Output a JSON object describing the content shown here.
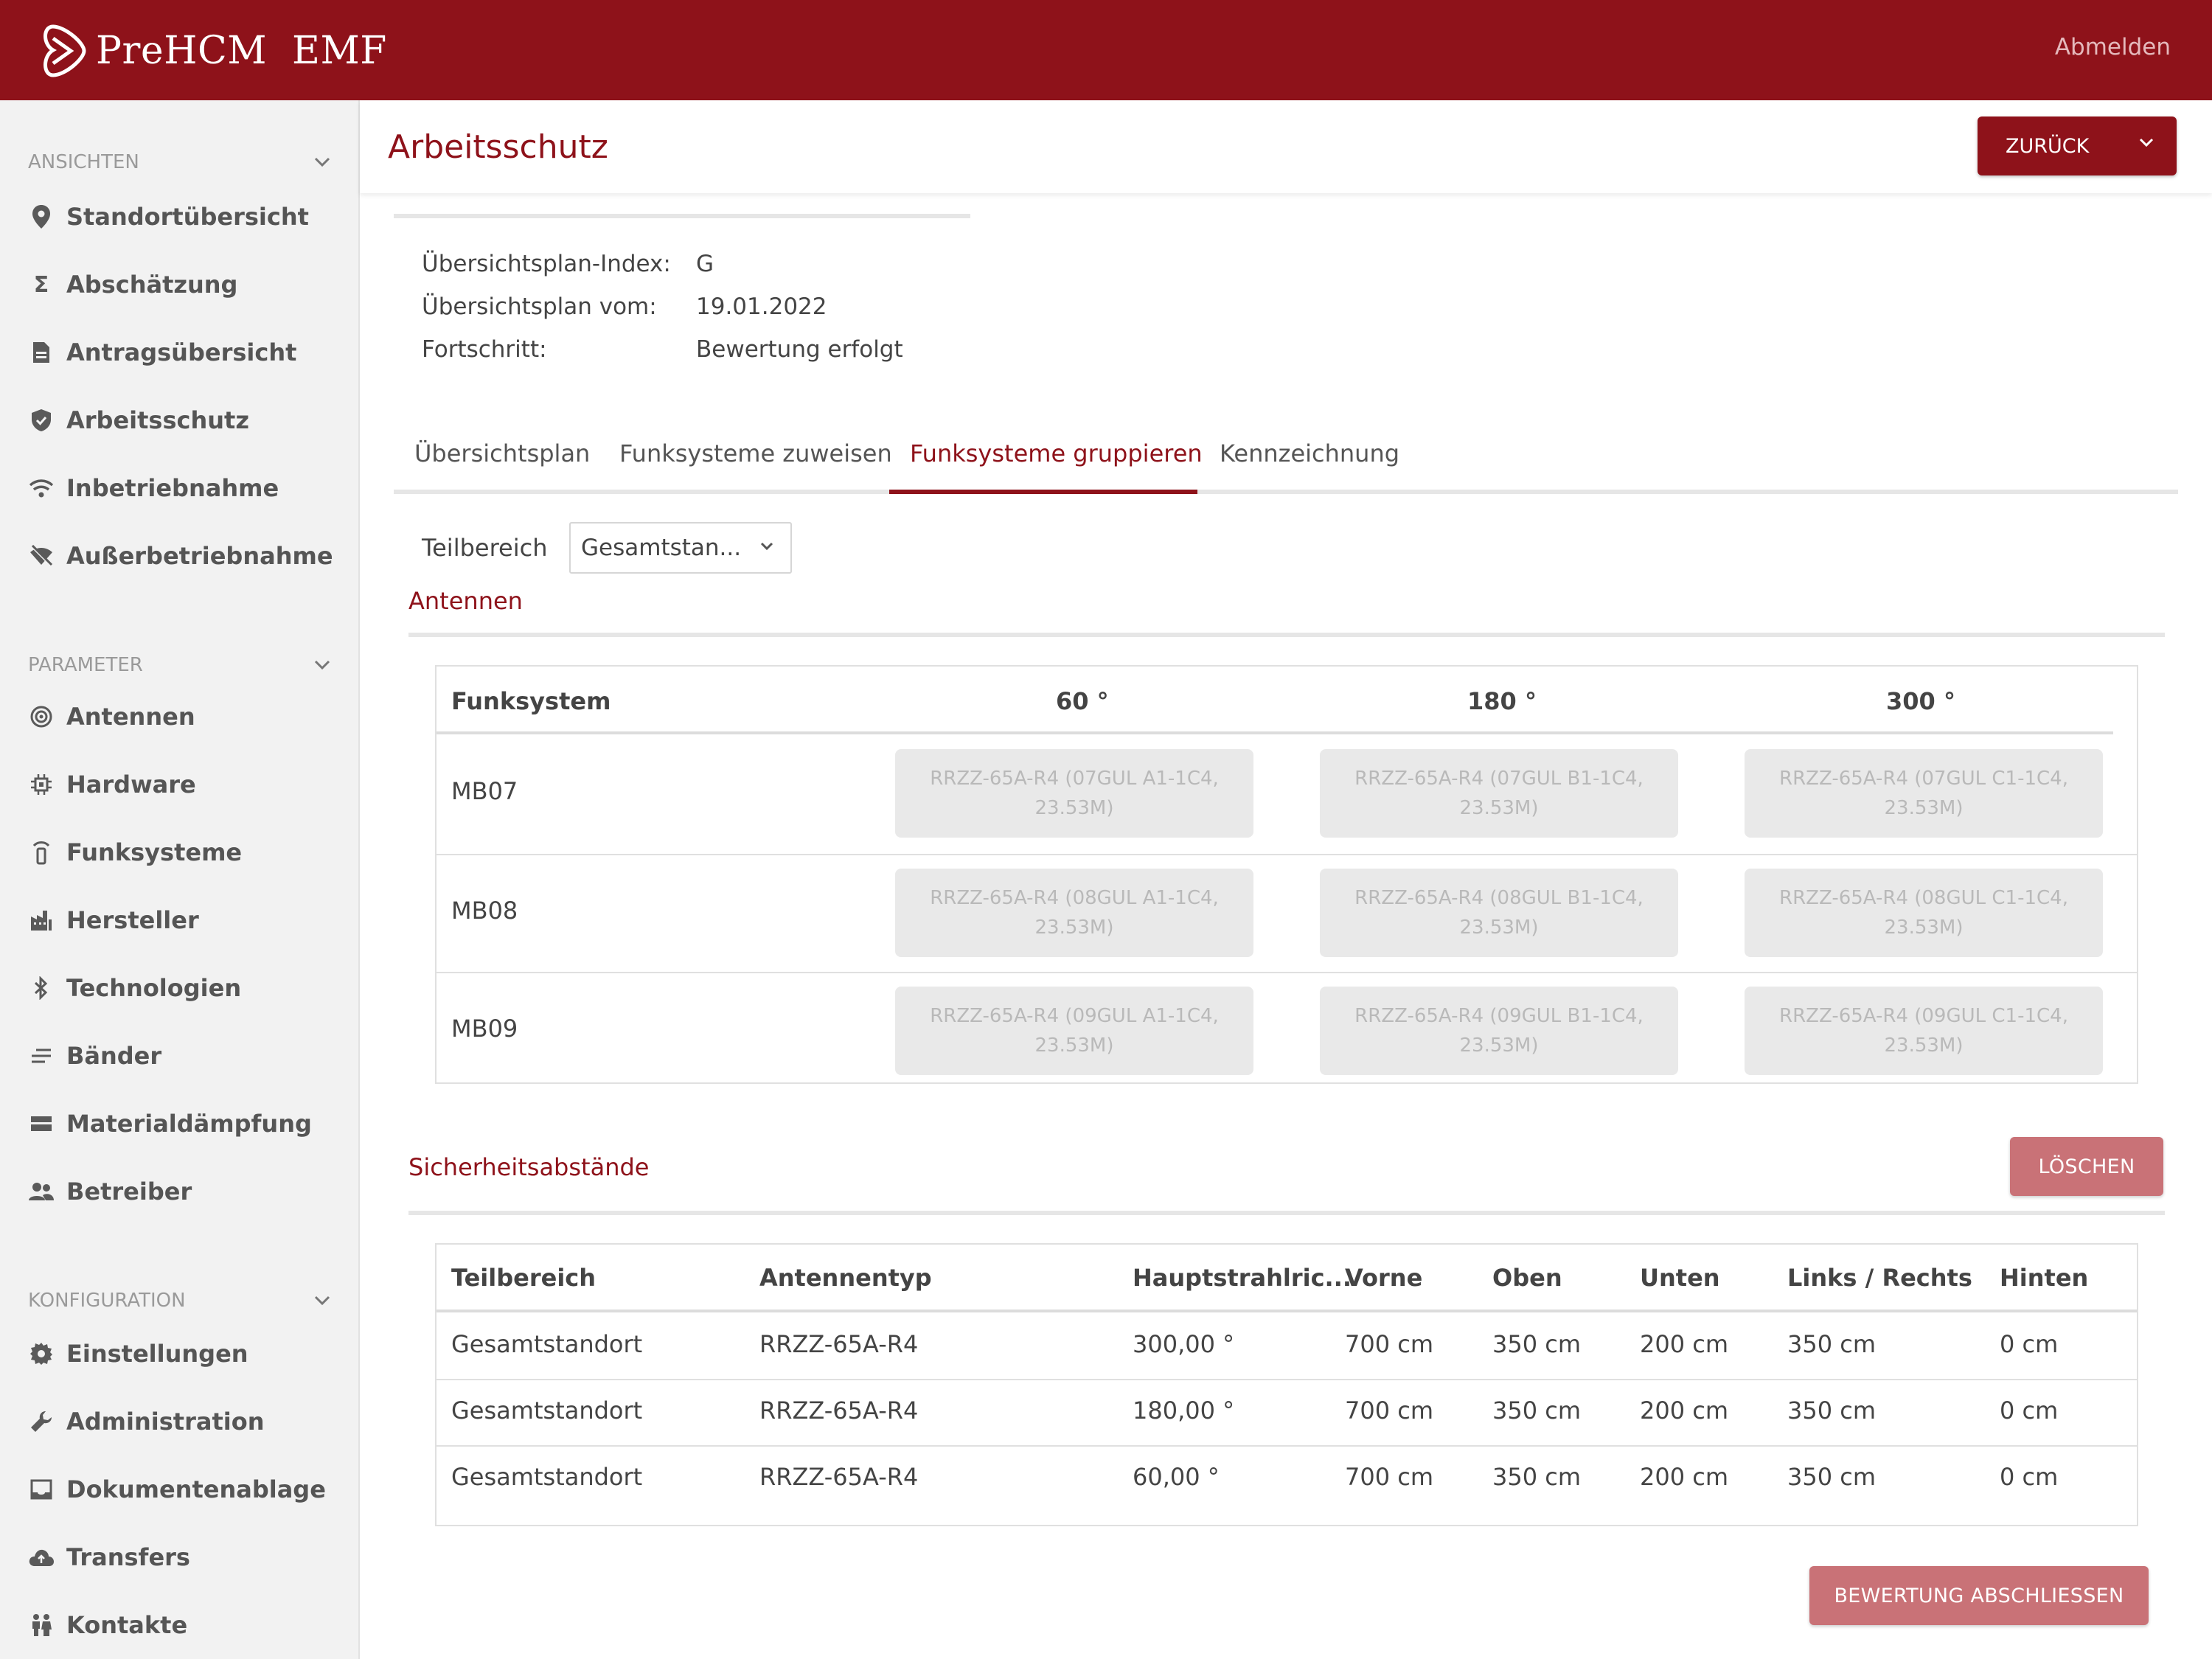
{
  "app": {
    "brand": "PreHCM  EMF",
    "logout_label": "Abmelden",
    "accent_color": "#8e121a"
  },
  "sidebar": {
    "sections": [
      {
        "title": "ANSICHTEN",
        "items": [
          {
            "label": "Standortübersicht",
            "icon": "location-pin-icon"
          },
          {
            "label": "Abschätzung",
            "icon": "sigma-icon"
          },
          {
            "label": "Antragsübersicht",
            "icon": "document-icon"
          },
          {
            "label": "Arbeitsschutz",
            "icon": "shield-icon"
          },
          {
            "label": "Inbetriebnahme",
            "icon": "wifi-icon"
          },
          {
            "label": "Außerbetriebnahme",
            "icon": "wifi-off-icon"
          }
        ]
      },
      {
        "title": "PARAMETER",
        "items": [
          {
            "label": "Antennen",
            "icon": "antenna-icon"
          },
          {
            "label": "Hardware",
            "icon": "chip-icon"
          },
          {
            "label": "Funksysteme",
            "icon": "radio-tower-icon"
          },
          {
            "label": "Hersteller",
            "icon": "factory-icon"
          },
          {
            "label": "Technologien",
            "icon": "bluetooth-icon"
          },
          {
            "label": "Bänder",
            "icon": "lines-icon"
          },
          {
            "label": "Materialdämpfung",
            "icon": "material-icon"
          },
          {
            "label": "Betreiber",
            "icon": "people-icon"
          }
        ]
      },
      {
        "title": "KONFIGURATION",
        "items": [
          {
            "label": "Einstellungen",
            "icon": "gear-icon"
          },
          {
            "label": "Administration",
            "icon": "wrench-icon"
          },
          {
            "label": "Dokumentenablage",
            "icon": "inbox-icon"
          },
          {
            "label": "Transfers",
            "icon": "cloud-upload-icon"
          },
          {
            "label": "Kontakte",
            "icon": "contacts-icon"
          }
        ]
      }
    ]
  },
  "header": {
    "title": "Arbeitsschutz",
    "back_label": "ZURÜCK"
  },
  "info": [
    {
      "label": "Übersichtsplan-Index:",
      "value": "G"
    },
    {
      "label": "Übersichtsplan vom:",
      "value": "19.01.2022"
    },
    {
      "label": "Fortschritt:",
      "value": "Bewertung erfolgt"
    }
  ],
  "tabs": [
    {
      "label": "Übersichtsplan",
      "active": false
    },
    {
      "label": "Funksysteme zuweisen",
      "active": false
    },
    {
      "label": "Funksysteme gruppieren",
      "active": true
    },
    {
      "label": "Kennzeichnung",
      "active": false
    }
  ],
  "filter": {
    "label": "Teilbereich",
    "value": "Gesamtstan..."
  },
  "antennen": {
    "title": "Antennen",
    "columns": [
      "Funksystem",
      "60 °",
      "180 °",
      "300 °"
    ],
    "rows": [
      {
        "name": "MB07",
        "cells": [
          "RRZZ-65A-R4 (07GUL A1-1C4, 23.53M)",
          "RRZZ-65A-R4 (07GUL B1-1C4, 23.53M)",
          "RRZZ-65A-R4 (07GUL C1-1C4, 23.53M)"
        ]
      },
      {
        "name": "MB08",
        "cells": [
          "RRZZ-65A-R4 (08GUL A1-1C4, 23.53M)",
          "RRZZ-65A-R4 (08GUL B1-1C4, 23.53M)",
          "RRZZ-65A-R4 (08GUL C1-1C4, 23.53M)"
        ]
      },
      {
        "name": "MB09",
        "cells": [
          "RRZZ-65A-R4 (09GUL A1-1C4, 23.53M)",
          "RRZZ-65A-R4 (09GUL B1-1C4, 23.53M)",
          "RRZZ-65A-R4 (09GUL C1-1C4, 23.53M)"
        ]
      }
    ]
  },
  "sicherheit": {
    "title": "Sicherheitsabstände",
    "delete_label": "LÖSCHEN",
    "columns": [
      "Teilbereich",
      "Antennentyp",
      "Hauptstrahlric...",
      "Vorne",
      "Oben",
      "Unten",
      "Links / Rechts",
      "Hinten"
    ],
    "rows": [
      [
        "Gesamtstandort",
        "RRZZ-65A-R4",
        "300,00 °",
        "700 cm",
        "350 cm",
        "200 cm",
        "350 cm",
        "0 cm"
      ],
      [
        "Gesamtstandort",
        "RRZZ-65A-R4",
        "180,00 °",
        "700 cm",
        "350 cm",
        "200 cm",
        "350 cm",
        "0 cm"
      ],
      [
        "Gesamtstandort",
        "RRZZ-65A-R4",
        "60,00 °",
        "700 cm",
        "350 cm",
        "200 cm",
        "350 cm",
        "0 cm"
      ]
    ]
  },
  "footer": {
    "complete_label": "BEWERTUNG ABSCHLIESSEN"
  }
}
